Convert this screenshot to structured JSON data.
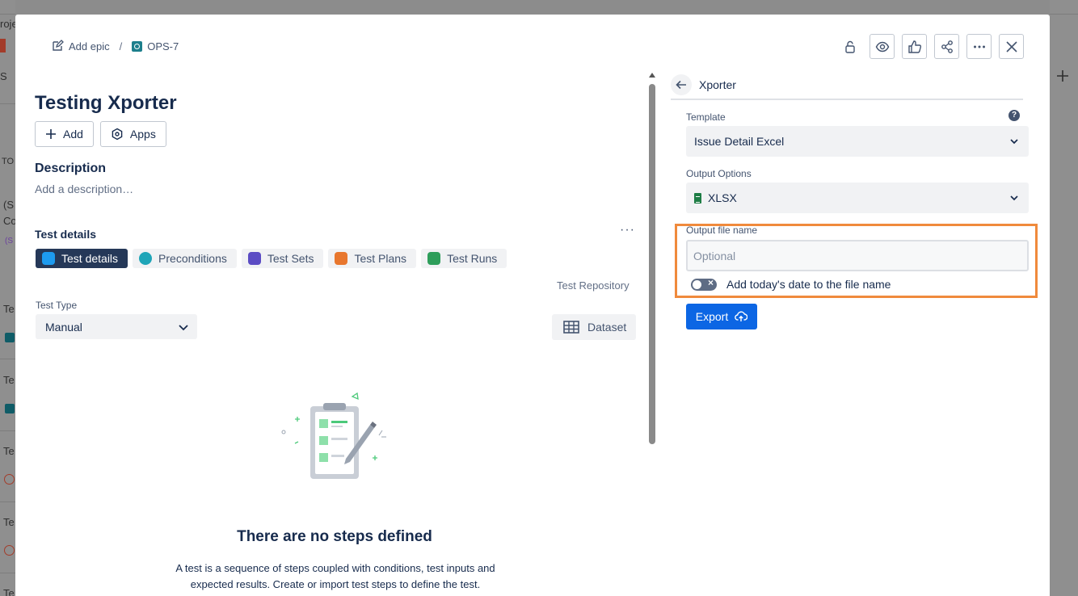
{
  "background": {
    "fragments": [
      "roje",
      "S",
      "TO",
      "(S",
      "Co",
      "(S",
      "Te",
      "Te",
      "Te",
      "Te",
      "Te"
    ]
  },
  "header": {
    "add_epic_label": "Add epic",
    "separator": "/",
    "issue_key": "OPS-7"
  },
  "issue": {
    "title": "Testing Xporter",
    "add_label": "Add",
    "apps_label": "Apps",
    "description_heading": "Description",
    "description_placeholder": "Add a description…"
  },
  "test_details": {
    "heading": "Test details",
    "more_label": "···",
    "tabs": [
      {
        "label": "Test details",
        "color": "#1d9bf0"
      },
      {
        "label": "Preconditions",
        "color": "#1fa5b8"
      },
      {
        "label": "Test Sets",
        "color": "#5b4cc4"
      },
      {
        "label": "Test Plans",
        "color": "#e8772e"
      },
      {
        "label": "Test Runs",
        "color": "#2e9e5b"
      }
    ],
    "repository_label": "Test Repository",
    "test_type_label": "Test Type",
    "test_type_value": "Manual",
    "dataset_label": "Dataset",
    "empty_heading": "There are no steps defined",
    "empty_text": "A test is a sequence of steps coupled with conditions, test inputs and expected results. Create or import test steps to define the test."
  },
  "xporter": {
    "title": "Xporter",
    "template_label": "Template",
    "help_label": "?",
    "template_value": "Issue Detail Excel",
    "output_options_label": "Output Options",
    "output_value": "XLSX",
    "file_name_label": "Output file name",
    "file_name_placeholder": "Optional",
    "date_toggle_label": "Add today's date to the file name",
    "date_toggle_on": false,
    "export_label": "Export"
  },
  "colors": {
    "accent": "#0c66e4",
    "highlight": "#f08a3c",
    "active_tab": "#253858"
  }
}
